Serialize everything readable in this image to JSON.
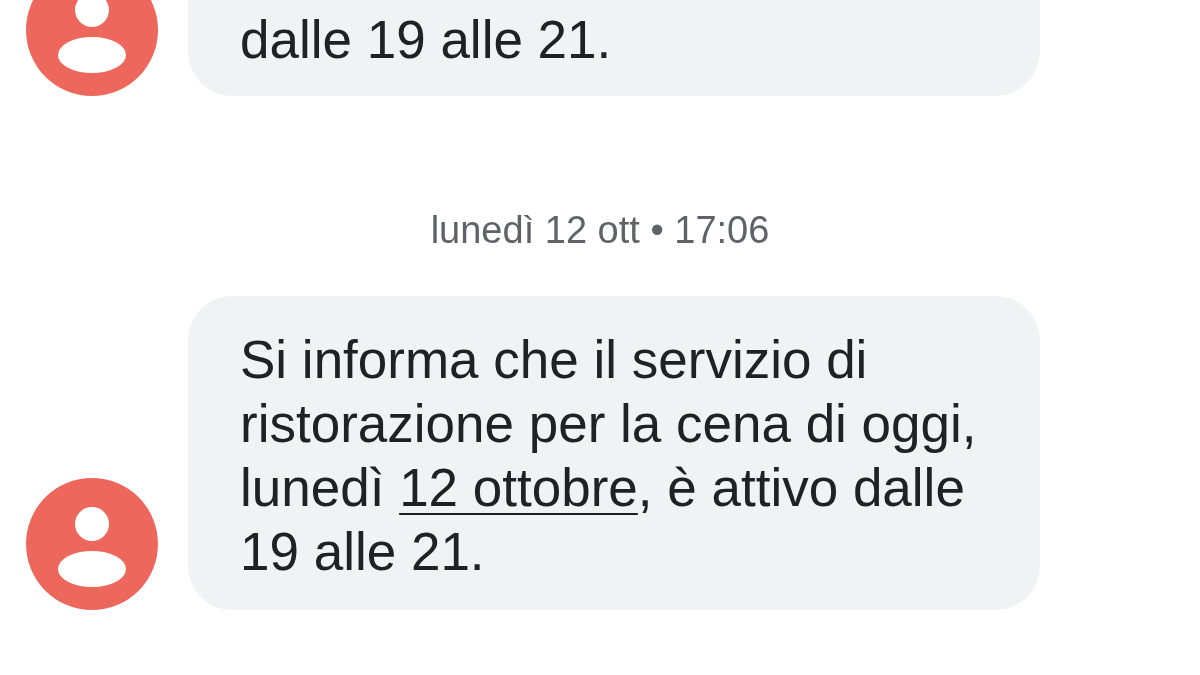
{
  "conversation": [
    {
      "kind": "message",
      "segments": [
        {
          "kind": "text",
          "text": "dalle 19 alle 21."
        }
      ]
    },
    {
      "kind": "timestamp",
      "text": "lunedì 12 ott • 17:06"
    },
    {
      "kind": "message",
      "segments": [
        {
          "kind": "text",
          "text": "Si informa che il servizio di ristorazione per la cena di oggi, lunedì "
        },
        {
          "kind": "link",
          "text": "12 ottobre"
        },
        {
          "kind": "text",
          "text": ", è attivo dalle 19 alle 21."
        }
      ]
    }
  ]
}
